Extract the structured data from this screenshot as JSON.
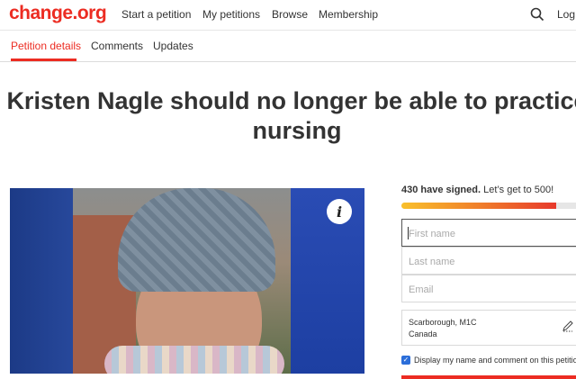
{
  "brand": {
    "logo": "change.org",
    "accent": "#ec2c22"
  },
  "nav": {
    "start": "Start a petition",
    "my": "My petitions",
    "browse": "Browse",
    "membership": "Membership",
    "login": "Log in",
    "search_icon": "search-icon"
  },
  "tabs": [
    {
      "label": "Petition details",
      "active": true
    },
    {
      "label": "Comments",
      "active": false
    },
    {
      "label": "Updates",
      "active": false
    }
  ],
  "petition": {
    "title": "Kristen Nagle should no longer be able to practice nursing",
    "info_icon": "i"
  },
  "sign": {
    "signed_count": "430 have signed.",
    "goal_text": "Let’s get to 500!",
    "progress_fraction": 0.86,
    "first_name_placeholder": "First name",
    "last_name_placeholder": "Last name",
    "email_placeholder": "Email",
    "location_line1": "Scarborough, M1C",
    "location_line2": "Canada",
    "display_label": "Display my name and comment on this petition",
    "display_checked": true
  }
}
